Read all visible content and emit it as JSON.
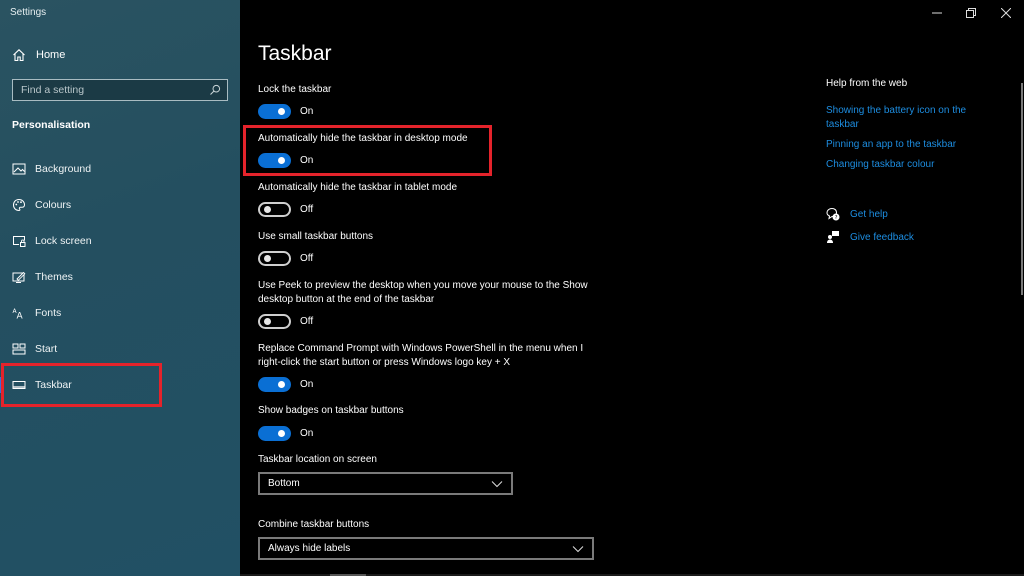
{
  "window": {
    "title": "Settings",
    "controls": [
      "minimize",
      "restore",
      "close"
    ]
  },
  "sidebar": {
    "home_label": "Home",
    "search": {
      "placeholder": "Find a setting",
      "value": ""
    },
    "section_title": "Personalisation",
    "items": [
      {
        "label": "Background",
        "icon": "picture-icon",
        "active": false
      },
      {
        "label": "Colours",
        "icon": "palette-icon",
        "active": false
      },
      {
        "label": "Lock screen",
        "icon": "lock-screen-icon",
        "active": false
      },
      {
        "label": "Themes",
        "icon": "themes-icon",
        "active": false
      },
      {
        "label": "Fonts",
        "icon": "fonts-icon",
        "active": false
      },
      {
        "label": "Start",
        "icon": "start-icon",
        "active": false
      },
      {
        "label": "Taskbar",
        "icon": "taskbar-icon",
        "active": true
      }
    ]
  },
  "main": {
    "title": "Taskbar",
    "settings": [
      {
        "label": "Lock the taskbar",
        "state": "On",
        "on": true
      },
      {
        "label": "Automatically hide the taskbar in desktop mode",
        "state": "On",
        "on": true
      },
      {
        "label": "Automatically hide the taskbar in tablet mode",
        "state": "Off",
        "on": false
      },
      {
        "label": "Use small taskbar buttons",
        "state": "Off",
        "on": false
      },
      {
        "label": "Use Peek to preview the desktop when you move your mouse to the Show desktop button at the end of the taskbar",
        "state": "Off",
        "on": false
      },
      {
        "label": "Replace Command Prompt with Windows PowerShell in the menu when I right-click the start button or press Windows logo key + X",
        "state": "On",
        "on": true
      },
      {
        "label": "Show badges on taskbar buttons",
        "state": "On",
        "on": true
      }
    ],
    "location": {
      "label": "Taskbar location on screen",
      "value": "Bottom"
    },
    "combine": {
      "label": "Combine taskbar buttons",
      "value": "Always hide labels"
    }
  },
  "help": {
    "title": "Help from the web",
    "links": [
      "Showing the battery icon on the taskbar",
      "Pinning an app to the taskbar",
      "Changing taskbar colour"
    ],
    "get_help": "Get help",
    "give_feedback": "Give feedback"
  },
  "colors": {
    "accent": "#0a6fd4",
    "link": "#1d8de0",
    "highlight_box": "#e5232b",
    "sidebar_bg": "#244f60"
  }
}
